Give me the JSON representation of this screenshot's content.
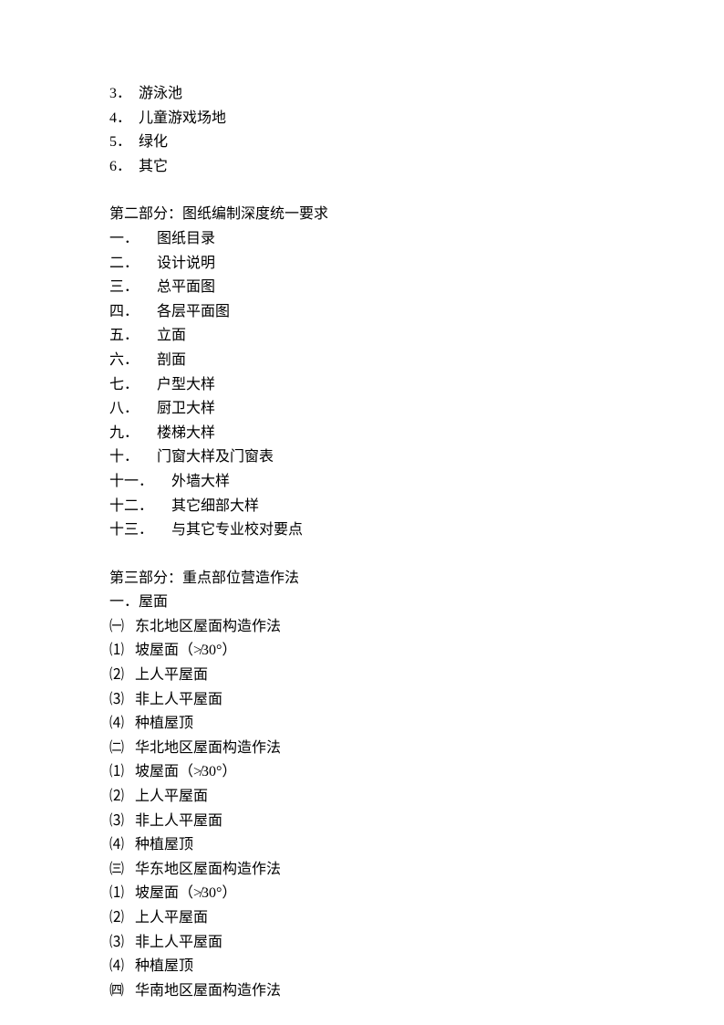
{
  "topItems": [
    {
      "num": "3．",
      "text": "游泳池"
    },
    {
      "num": "4．",
      "text": "儿童游戏场地"
    },
    {
      "num": "5．",
      "text": "绿化"
    },
    {
      "num": "6．",
      "text": "其它"
    }
  ],
  "section2": {
    "title": "第二部分：图纸编制深度统一要求",
    "items": [
      {
        "num": "一．",
        "text": "图纸目录"
      },
      {
        "num": "二．",
        "text": "设计说明"
      },
      {
        "num": "三．",
        "text": "总平面图"
      },
      {
        "num": "四．",
        "text": "各层平面图"
      },
      {
        "num": "五．",
        "text": "立面"
      },
      {
        "num": "六．",
        "text": "剖面"
      },
      {
        "num": "七．",
        "text": "户型大样"
      },
      {
        "num": "八．",
        "text": "厨卫大样"
      },
      {
        "num": "九．",
        "text": "楼梯大样"
      },
      {
        "num": "十．",
        "text": "门窗大样及门窗表"
      },
      {
        "num": "十一．",
        "text": "外墙大样"
      },
      {
        "num": "十二．",
        "text": "其它细部大样"
      },
      {
        "num": "十三．",
        "text": "与其它专业校对要点"
      }
    ]
  },
  "section3": {
    "title": "第三部分：重点部位营造作法",
    "heading1": "一．屋面",
    "groups": [
      {
        "marker": "㈠",
        "title": "东北地区屋面构造作法",
        "items": [
          {
            "num": "⑴",
            "text": "坡屋面（≯30°）"
          },
          {
            "num": "⑵",
            "text": "上人平屋面"
          },
          {
            "num": "⑶",
            "text": "非上人平屋面"
          },
          {
            "num": "⑷",
            "text": "种植屋顶"
          }
        ]
      },
      {
        "marker": "㈡",
        "title": "华北地区屋面构造作法",
        "items": [
          {
            "num": "⑴",
            "text": "坡屋面（≯30°）"
          },
          {
            "num": "⑵",
            "text": "上人平屋面"
          },
          {
            "num": "⑶",
            "text": "非上人平屋面"
          },
          {
            "num": "⑷",
            "text": "种植屋顶"
          }
        ]
      },
      {
        "marker": "㈢",
        "title": "华东地区屋面构造作法",
        "items": [
          {
            "num": "⑴",
            "text": "坡屋面（≯30°）"
          },
          {
            "num": "⑵",
            "text": "上人平屋面"
          },
          {
            "num": "⑶",
            "text": "非上人平屋面"
          },
          {
            "num": "⑷",
            "text": "种植屋顶"
          }
        ]
      },
      {
        "marker": "㈣",
        "title": "华南地区屋面构造作法",
        "items": []
      }
    ]
  }
}
